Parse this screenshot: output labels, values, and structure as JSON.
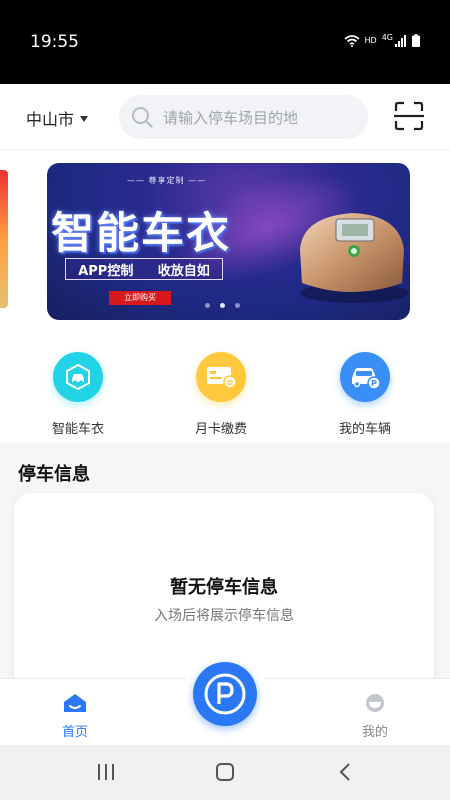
{
  "status_bar": {
    "time": "19:55",
    "network": "HD",
    "signal": "4G"
  },
  "header": {
    "city": "中山市",
    "search_placeholder": "请输入停车场目的地"
  },
  "banner": {
    "subtitle": "—— 尊享定制 ——",
    "title": "智能车衣",
    "feature_left": "APP控制",
    "feature_right": "收放自如",
    "cta": "立即购买",
    "slide_count": 3,
    "active_slide": 2
  },
  "quick_actions": [
    {
      "label": "智能车衣",
      "icon": "car-cover-icon",
      "color": "#22d3e6"
    },
    {
      "label": "月卡缴费",
      "icon": "monthly-card-icon",
      "color": "#ffc83d"
    },
    {
      "label": "我的车辆",
      "icon": "my-car-icon",
      "color": "#3a8ff7"
    }
  ],
  "parking_info": {
    "title": "停车信息",
    "empty_title": "暂无停车信息",
    "empty_subtitle": "入场后将展示停车信息"
  },
  "tabbar": {
    "home_label": "首页",
    "mine_label": "我的",
    "active": "home",
    "accent_color": "#2b78f5",
    "park_icon": "parking-p-icon"
  }
}
